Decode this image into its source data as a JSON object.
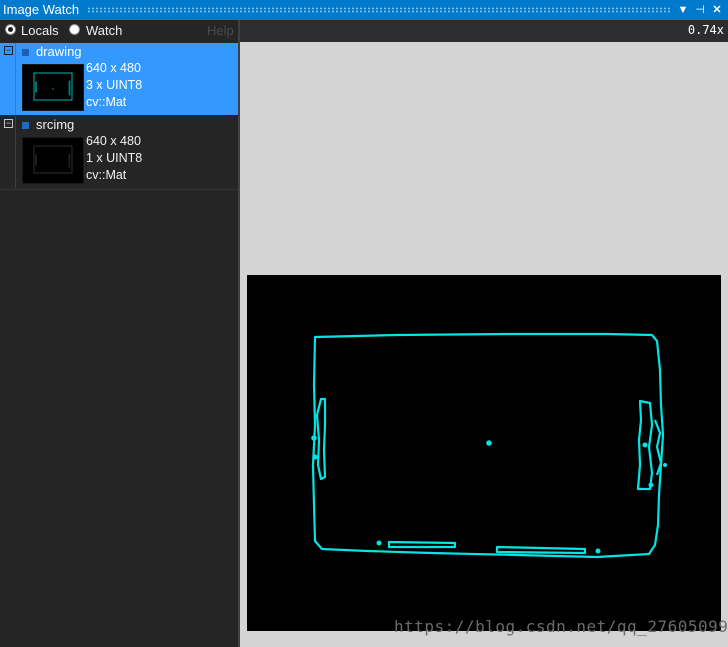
{
  "window": {
    "title": "Image Watch",
    "menu_glyph": "▼",
    "pin_glyph": "⊣",
    "close_glyph": "✕"
  },
  "toolbar": {
    "locals_label": "Locals",
    "watch_label": "Watch",
    "help_label": "Help",
    "selected": "Locals"
  },
  "variables": [
    {
      "name": "drawing",
      "dimensions": "640 x 480",
      "channels": "3 x UINT8",
      "type": "cv::Mat",
      "selected": true,
      "expander": "−"
    },
    {
      "name": "srcimg",
      "dimensions": "640 x 480",
      "channels": "1 x UINT8",
      "type": "cv::Mat",
      "selected": false,
      "expander": "−"
    }
  ],
  "viewer": {
    "zoom": "0.74x",
    "watermark": "https://blog.csdn.net/qq_27605099",
    "contour_color": "#00e5e5"
  }
}
